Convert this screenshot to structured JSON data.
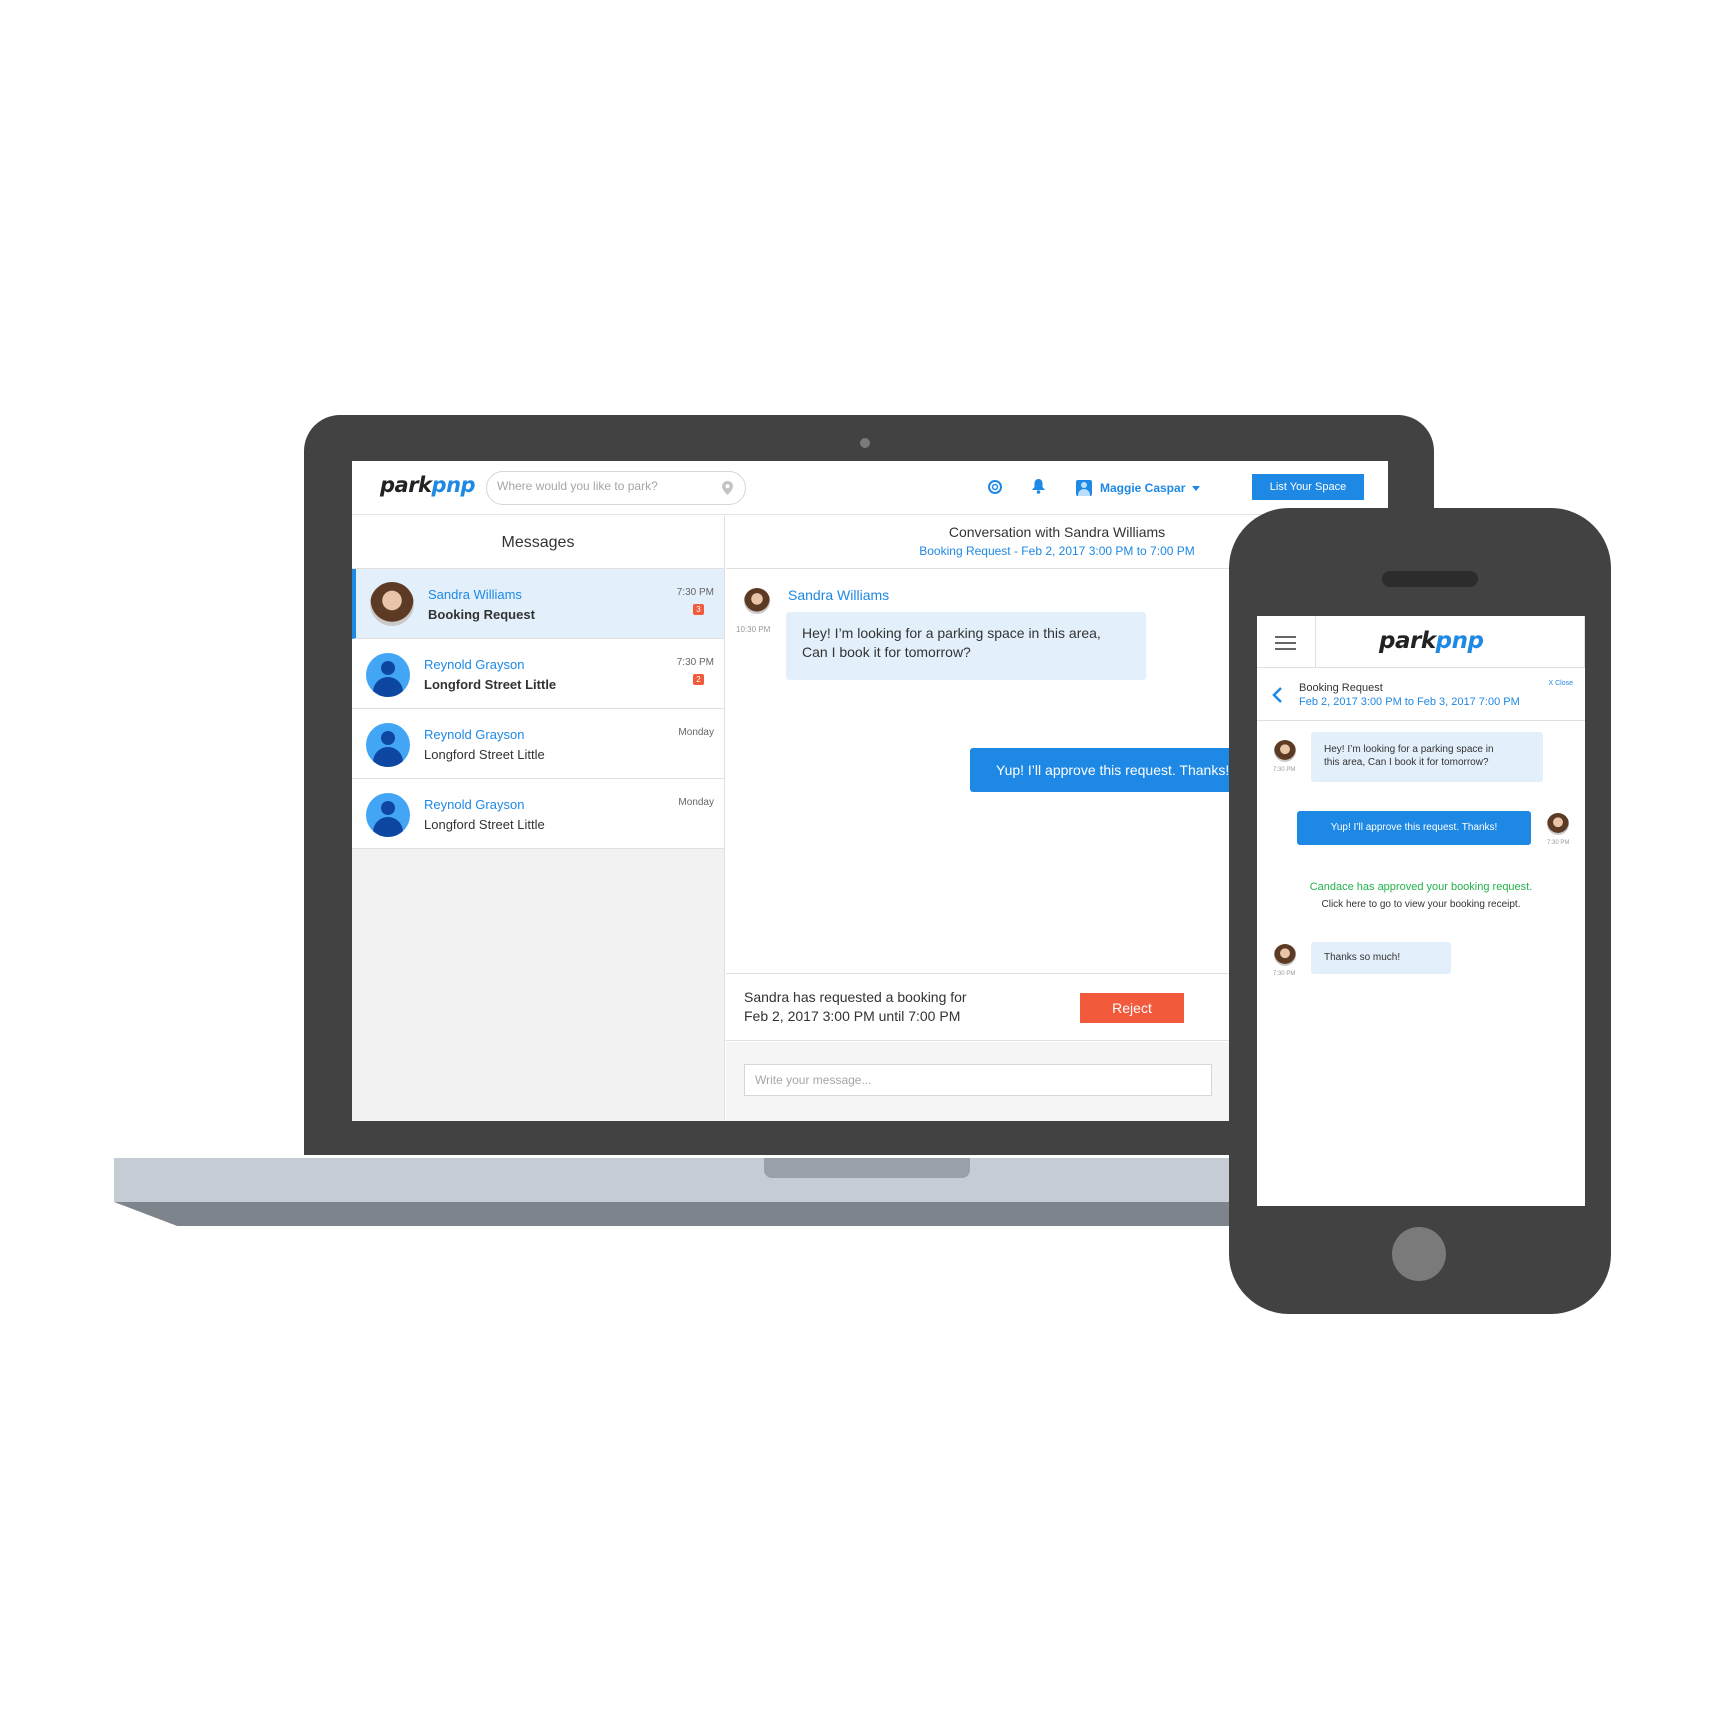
{
  "brand": {
    "logo_part1": "park",
    "logo_part2": "pnp"
  },
  "desktop": {
    "nav": {
      "search_placeholder": "Where would you like to park?",
      "user_name": "Maggie Caspar",
      "list_space_label": "List Your Space"
    },
    "messages": {
      "title": "Messages",
      "items": [
        {
          "name": "Sandra Williams",
          "subtitle": "Booking Request",
          "time": "7:30 PM",
          "badge": "3"
        },
        {
          "name": "Reynold Grayson",
          "subtitle": "Longford Street Little",
          "time": "7:30 PM",
          "badge": "2"
        },
        {
          "name": "Reynold Grayson",
          "subtitle": "Longford Street Little",
          "time": "Monday"
        },
        {
          "name": "Reynold Grayson",
          "subtitle": "Longford Street Little",
          "time": "Monday"
        }
      ]
    },
    "conversation": {
      "title": "Conversation with Sandra Williams",
      "subtitle": "Booking Request - Feb 2, 2017 3:00 PM to 7:00 PM",
      "sender": "Sandra Williams",
      "incoming_time": "10:30 PM",
      "incoming_line1": "Hey! I’m looking for a parking space in this area,",
      "incoming_line2": "Can I book it for tomorrow?",
      "outgoing": "Yup! I’ll approve this request. Thanks!"
    },
    "booking": {
      "line1": "Sandra has requested a booking for",
      "line2": "Feb 2, 2017 3:00 PM until 7:00 PM",
      "reject_label": "Reject"
    },
    "compose_placeholder": "Write your message..."
  },
  "mobile": {
    "header_title": "Booking Request",
    "header_dates": "Feb 2, 2017 3:00 PM to Feb 3, 2017 7:00 PM",
    "close_label": "X Close",
    "msg1_line1": "Hey! I’m looking for a parking space in",
    "msg1_line2": "this area, Can I book it for tomorrow?",
    "msg1_time": "7:30 PM",
    "msg2": "Yup! I’ll approve this request. Thanks!",
    "msg2_time": "7:30 PM",
    "approved": "Candace has approved your booking request.",
    "receipt": "Click here to go to view your booking receipt.",
    "msg3": "Thanks so much!",
    "msg3_time": "7:30 PM"
  }
}
